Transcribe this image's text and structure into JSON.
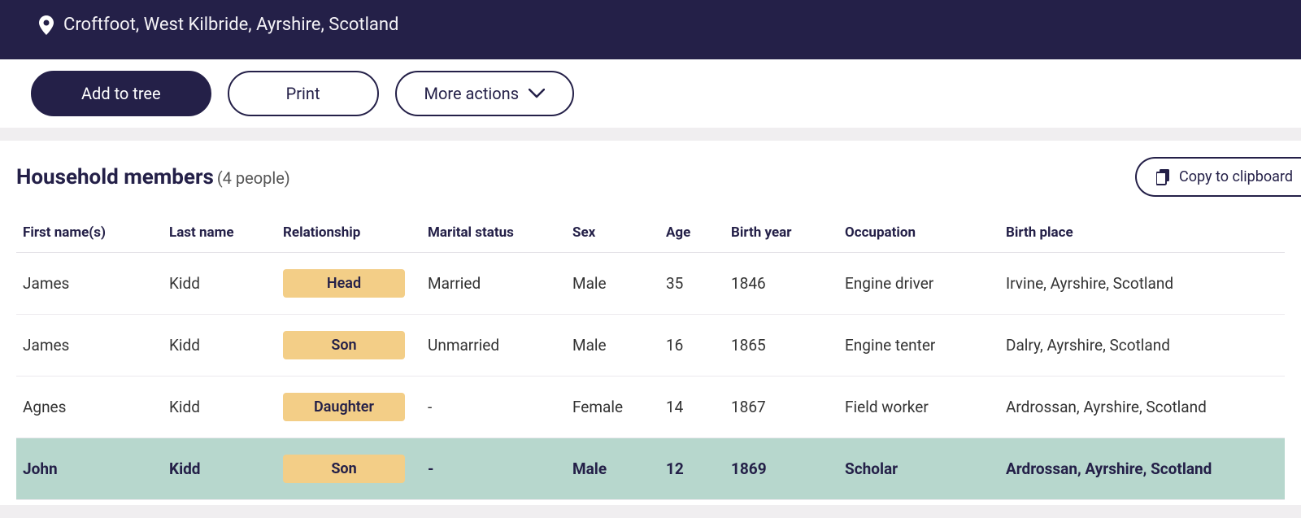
{
  "header": {
    "location": "Croftfoot, West Kilbride, Ayrshire, Scotland"
  },
  "actions": {
    "add_to_tree": "Add to tree",
    "print": "Print",
    "more": "More actions"
  },
  "panel": {
    "title": "Household members",
    "count_label": "(4 people)",
    "copy_label": "Copy to clipboard"
  },
  "table": {
    "headers": {
      "first": "First name(s)",
      "last": "Last name",
      "rel": "Relationship",
      "mar": "Marital status",
      "sex": "Sex",
      "age": "Age",
      "year": "Birth year",
      "occ": "Occupation",
      "place": "Birth place"
    },
    "rows": [
      {
        "first": "James",
        "last": "Kidd",
        "rel": "Head",
        "mar": "Married",
        "sex": "Male",
        "age": "35",
        "year": "1846",
        "occ": "Engine driver",
        "place": "Irvine, Ayrshire, Scotland",
        "highlight": false
      },
      {
        "first": "James",
        "last": "Kidd",
        "rel": "Son",
        "mar": "Unmarried",
        "sex": "Male",
        "age": "16",
        "year": "1865",
        "occ": "Engine tenter",
        "place": "Dalry, Ayrshire, Scotland",
        "highlight": false
      },
      {
        "first": "Agnes",
        "last": "Kidd",
        "rel": "Daughter",
        "mar": "-",
        "sex": "Female",
        "age": "14",
        "year": "1867",
        "occ": "Field worker",
        "place": "Ardrossan, Ayrshire, Scotland",
        "highlight": false
      },
      {
        "first": "John",
        "last": "Kidd",
        "rel": "Son",
        "mar": "-",
        "sex": "Male",
        "age": "12",
        "year": "1869",
        "occ": "Scholar",
        "place": "Ardrossan, Ayrshire, Scotland",
        "highlight": true
      }
    ]
  }
}
